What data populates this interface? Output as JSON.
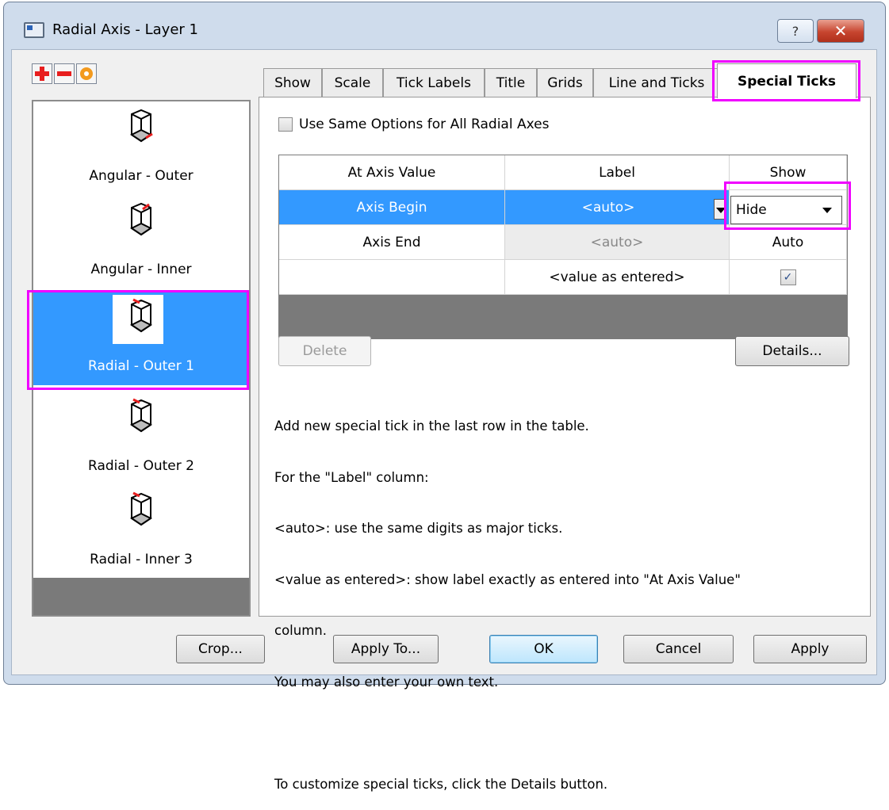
{
  "window": {
    "title": "Radial Axis - Layer 1",
    "help_label": "?",
    "close_label": "✕"
  },
  "toolbar": {
    "add_icon": "plus-icon",
    "remove_icon": "minus-icon",
    "reset_icon": "circle-icon",
    "add_color": "#e81e1e",
    "remove_color": "#e81e1e",
    "reset_color": "#f39a1e"
  },
  "axes_list": [
    {
      "label": "Angular - Outer",
      "icon": "axis-cube-icon"
    },
    {
      "label": "Angular - Inner",
      "icon": "axis-cube-icon"
    },
    {
      "label": "Radial - Outer 1",
      "icon": "axis-cube-icon",
      "selected": true
    },
    {
      "label": "Radial - Outer 2",
      "icon": "axis-cube-icon"
    },
    {
      "label": "Radial - Inner 3",
      "icon": "axis-cube-icon"
    }
  ],
  "tabs": [
    "Show",
    "Scale",
    "Tick Labels",
    "Title",
    "Grids",
    "Line and Ticks",
    "Special Ticks"
  ],
  "active_tab": "Special Ticks",
  "special_ticks": {
    "same_options_label": "Use Same Options for All Radial Axes",
    "columns": [
      "At Axis Value",
      "Label",
      "Show"
    ],
    "rows": [
      {
        "value": "Axis Begin",
        "label": "<auto>",
        "show": "Hide"
      },
      {
        "value": "Axis End",
        "label": "<auto>",
        "show": "Auto"
      },
      {
        "value": "",
        "label": "<value as entered>",
        "show": "✓"
      }
    ],
    "delete_label": "Delete",
    "details_label": "Details...",
    "help_lines": [
      "Add new special tick in the last row in the table.",
      "For the \"Label\" column:",
      "<auto>: use the same digits as major ticks.",
      "<value as entered>: show label exactly as entered into \"At Axis Value\"",
      "column.",
      "You may also enter your own text.",
      "",
      "To customize special ticks, click the Details button."
    ]
  },
  "footer": {
    "crop": "Crop...",
    "apply_to": "Apply To...",
    "ok": "OK",
    "cancel": "Cancel",
    "apply": "Apply"
  },
  "colors": {
    "selection": "#3399ff",
    "highlight": "#f000ff",
    "window_frame": "#cfdcec"
  }
}
